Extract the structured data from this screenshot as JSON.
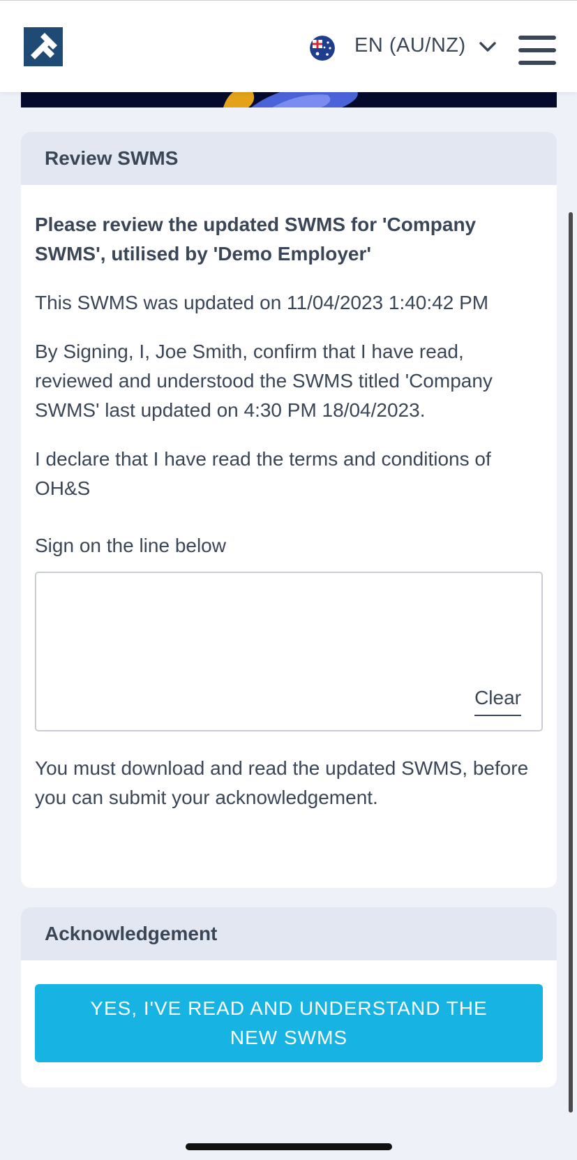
{
  "header": {
    "language_label": "EN (AU/NZ)",
    "logo_icon": "company-logo-icon",
    "flag_icon": "australia-flag-icon",
    "menu_icon": "hamburger-menu-icon"
  },
  "review": {
    "heading": "Review SWMS",
    "title": "Please review the updated SWMS for 'Company SWMS', utilised by 'Demo Employer'",
    "updated_text": "This SWMS was updated on 11/04/2023 1:40:42 PM",
    "confirmation_text": "By Signing, I, Joe Smith, confirm that I have read, reviewed and understood the SWMS titled 'Company SWMS' last updated on 4:30 PM 18/04/2023.",
    "declaration_text": "I declare that I have read the terms and conditions of OH&S",
    "sign_label": "Sign on the line below",
    "clear_label": "Clear",
    "notice_text": "You must download and read the updated SWMS, before you can submit your acknowledgement."
  },
  "acknowledgement": {
    "heading": "Acknowledgement",
    "button_label": "YES, I'VE READ AND UNDERSTAND THE NEW SWMS"
  },
  "colors": {
    "brand": "#1f4a73",
    "accent": "#17b4e3",
    "text": "#3a4656",
    "card_header": "#e3e7f2"
  }
}
